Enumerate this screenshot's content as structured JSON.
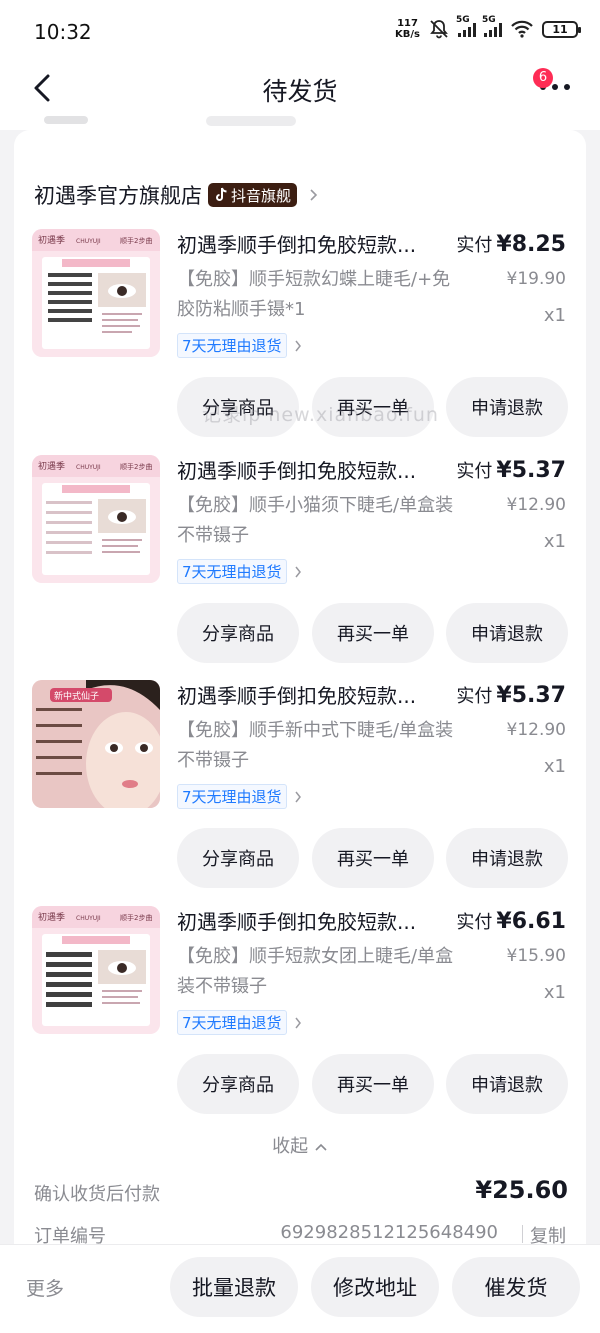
{
  "status_bar": {
    "time": "10:32",
    "net_speed_value": "117",
    "net_speed_unit": "KB/s",
    "sim1_label": "5G",
    "sim2_label": "5G",
    "battery": "11"
  },
  "nav": {
    "title": "待发货",
    "badge_count": "6"
  },
  "shop": {
    "name": "初遇季官方旗舰店",
    "tag": "抖音旗舰"
  },
  "products": [
    {
      "title": "初遇季顺手倒扣免胶短款...",
      "sku": "【免胶】顺手短款幻蝶上睫毛/+免胶防粘顺手镊*1",
      "paid_label": "实付",
      "paid_price": "¥8.25",
      "original_price": "¥19.90",
      "quantity": "x1",
      "refund_tag": "7天无理由退货"
    },
    {
      "title": "初遇季顺手倒扣免胶短款...",
      "sku": "【免胶】顺手小猫须下睫毛/单盒装不带镊子",
      "paid_label": "实付",
      "paid_price": "¥5.37",
      "original_price": "¥12.90",
      "quantity": "x1",
      "refund_tag": "7天无理由退货"
    },
    {
      "title": "初遇季顺手倒扣免胶短款...",
      "sku": "【免胶】顺手新中式下睫毛/单盒装不带镊子",
      "paid_label": "实付",
      "paid_price": "¥5.37",
      "original_price": "¥12.90",
      "quantity": "x1",
      "refund_tag": "7天无理由退货"
    },
    {
      "title": "初遇季顺手倒扣免胶短款...",
      "sku": "【免胶】顺手短款女团上睫毛/单盒装不带镊子",
      "paid_label": "实付",
      "paid_price": "¥6.61",
      "original_price": "¥15.90",
      "quantity": "x1",
      "refund_tag": "7天无理由退货"
    }
  ],
  "item_buttons": {
    "share": "分享商品",
    "rebuy": "再买一单",
    "refund": "申请退款"
  },
  "thumb_text": {
    "brand": "初遇季",
    "brand_en": "CHUYUJI",
    "slogan": "顺手2步曲",
    "promo": "新中式仙子"
  },
  "watermark": "记录ip new.xianbao.fun",
  "summary": {
    "collapse_label": "收起",
    "pay_after_label": "确认收货后付款",
    "total": "¥25.60",
    "order_label": "订单编号",
    "order_number": "6929828512125648490",
    "copy_label": "复制"
  },
  "bottom_bar": {
    "more": "更多",
    "batch_refund": "批量退款",
    "change_address": "修改地址",
    "urge_shipping": "催发货"
  }
}
